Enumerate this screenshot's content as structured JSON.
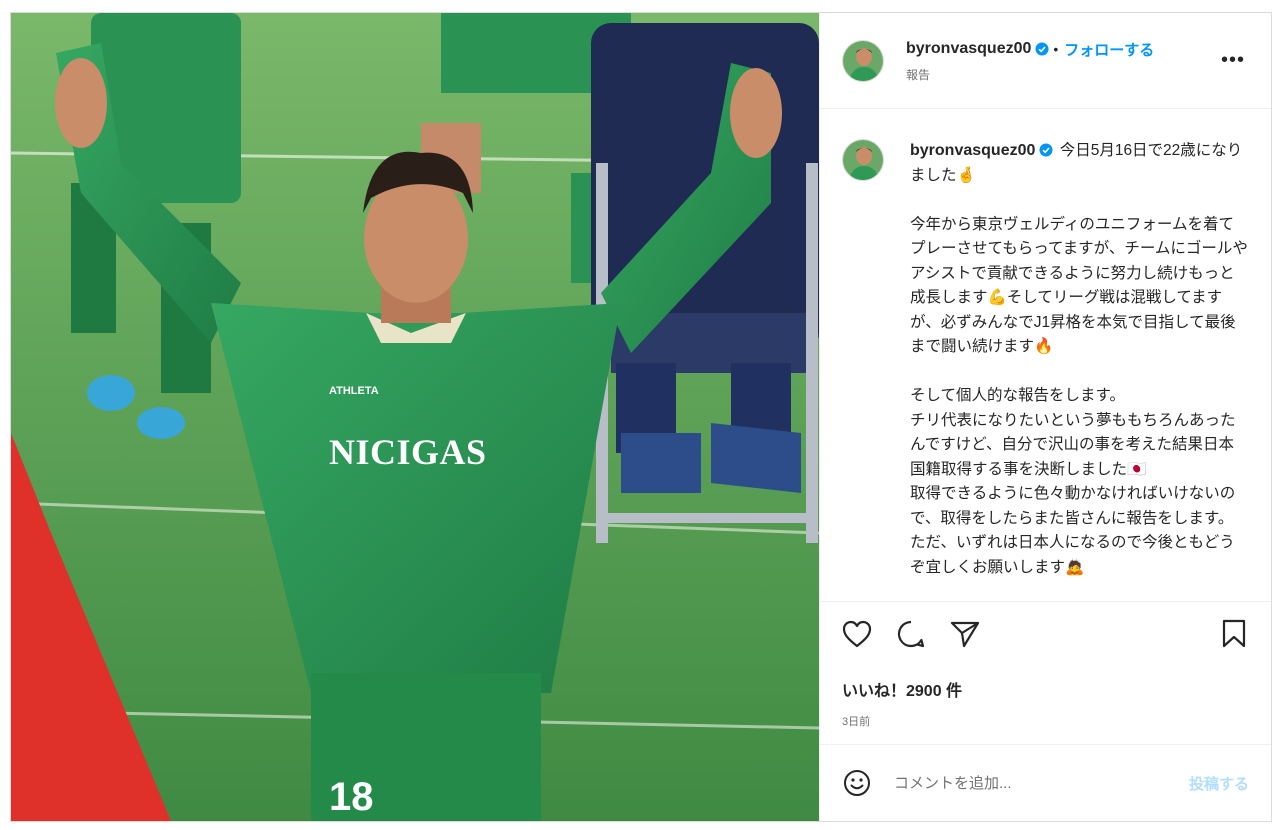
{
  "post": {
    "username": "byronvasquez00",
    "follow_label": "フォローする",
    "subtitle": "報告",
    "more_label": "•••",
    "separator": "•"
  },
  "media": {
    "jersey_text": "NICIGAS",
    "brand_text": "ATHLETA",
    "number": "18"
  },
  "caption": {
    "username": "byronvasquez00",
    "text": " 今日5月16日で22歳になりました🤞\n\n今年から東京ヴェルディのユニフォームを着てプレーさせてもらってますが、チームにゴールやアシストで貢献できるように努力し続けもっと成長します💪そしてリーグ戦は混戦してますが、必ずみんなでJ1昇格を本気で目指して最後まで闘い続けます🔥\n\nそして個人的な報告をします。\nチリ代表になりたいという夢ももちろんあったんですけど、自分で沢山の事を考えた結果日本国籍取得する事を決断しました🇯🇵\n取得できるように色々動かなければいけないので、取得をしたらまた皆さんに報告をします。\nただ、いずれは日本人になるので今後ともどうぞ宜しくお願いします🙇"
  },
  "icons": {
    "like": "heart-icon",
    "comment": "comment-bubble-icon",
    "share": "paper-plane-icon",
    "save": "bookmark-icon",
    "emoji": "smiley-icon",
    "verified": "verified-badge-icon"
  },
  "stats": {
    "likes": "いいね！2900 件",
    "time": "3日前"
  },
  "comment": {
    "placeholder": "コメントを追加...",
    "post_label": "投稿する"
  },
  "colors": {
    "accent": "#0095f6",
    "post_disabled": "#b2dffc",
    "jersey": "#2e9a55",
    "pitch": "#5fa35a"
  }
}
